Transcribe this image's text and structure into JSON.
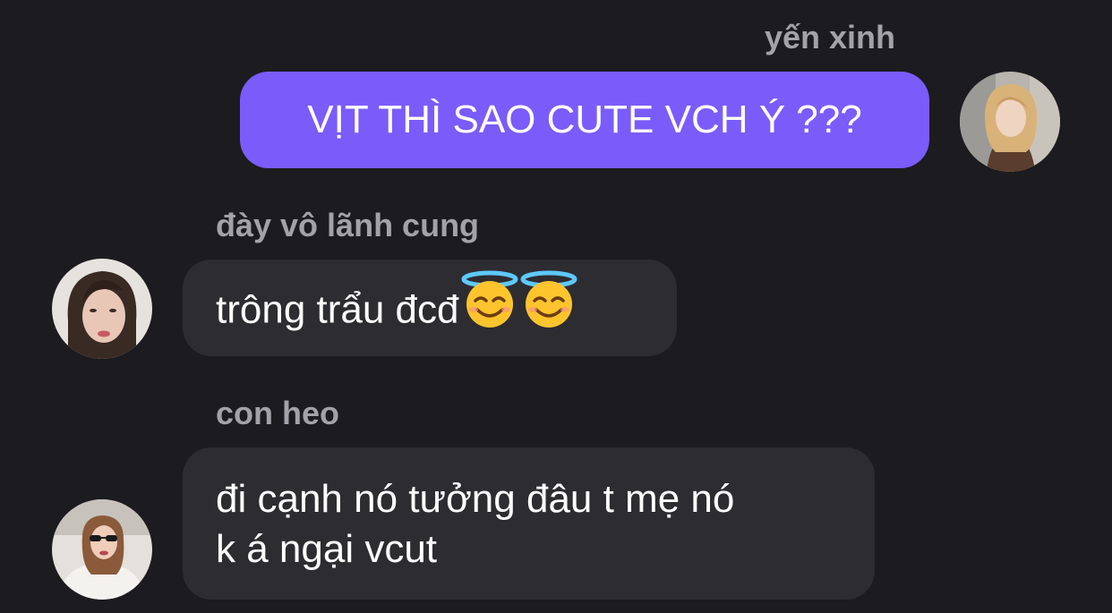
{
  "messages": [
    {
      "sender": "yến xinh",
      "text": "VỊT THÌ SAO CUTE VCH Ý ???",
      "direction": "outgoing"
    },
    {
      "sender": "đày vô lãnh cung",
      "text": "trông trẩu đcđ",
      "emojis": [
        "smiling-face-with-halo",
        "smiling-face-with-halo"
      ],
      "direction": "incoming"
    },
    {
      "sender": "con heo",
      "lines": [
        "đi cạnh nó tưởng đâu t mẹ nó",
        "k á ngại vcut"
      ],
      "direction": "incoming"
    }
  ],
  "colors": {
    "background": "#1c1b1f",
    "outgoing_bubble": "#7a5cfa",
    "incoming_bubble": "#2d2c30",
    "sender_name": "#a3a2a8"
  }
}
